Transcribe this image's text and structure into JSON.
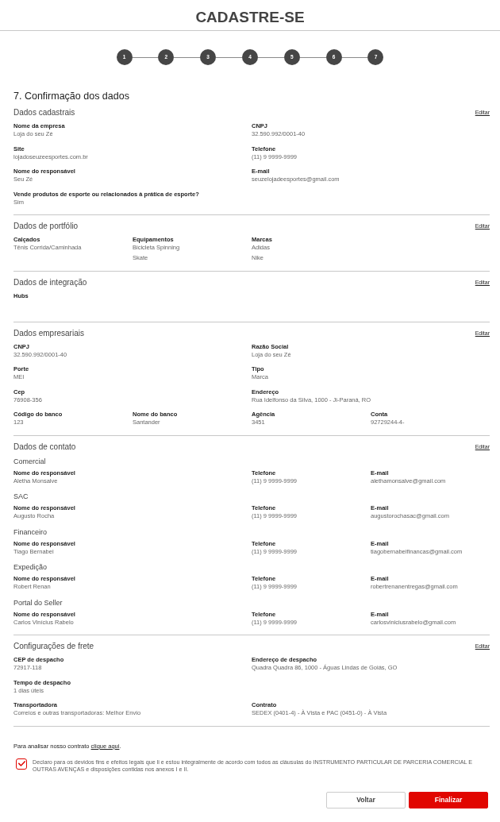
{
  "header": {
    "title": "CADASTRE-SE"
  },
  "steps": [
    {
      "label": "1"
    },
    {
      "label": "2"
    },
    {
      "label": "3"
    },
    {
      "label": "4"
    },
    {
      "label": "5"
    },
    {
      "label": "6"
    },
    {
      "label": "7"
    }
  ],
  "page_title": "7. Confirmação dos dados",
  "sections": [
    {
      "kind": "fields",
      "title": "Dados cadastrais",
      "edit_link": "Editar",
      "rows": [
        {
          "fields": [
            {
              "label": "Nome da empresa",
              "values": [
                "Loja do seu Zé"
              ]
            },
            {
              "label": "CNPJ",
              "values": [
                "32.590.992/0001-40"
              ]
            }
          ]
        },
        {
          "fields": [
            {
              "label": "Site",
              "values": [
                "lojadoseuzeesportes.com.br"
              ]
            },
            {
              "label": "Telefone",
              "values": [
                "(11) 9 9999-9999"
              ]
            }
          ]
        },
        {
          "fields": [
            {
              "label": "Nome do responsável",
              "values": [
                "Seu Zé"
              ]
            },
            {
              "label": "E-mail",
              "values": [
                "seuzelojadeesportes@gmail.com"
              ]
            }
          ]
        },
        {
          "fields": [
            {
              "label": "Vende produtos de esporte ou relacionados à prática de esporte?",
              "values": [
                "Sim"
              ]
            }
          ]
        }
      ]
    },
    {
      "kind": "portfolio",
      "title": "Dados de portfólio",
      "edit_link": "Editar",
      "rows": [
        {
          "fields": [
            {
              "label": "Calçados",
              "values": [
                "Tênis Corrida/Caminhada"
              ]
            },
            {
              "label": "Equipamentos",
              "values": [
                "Bicicleta Spinning",
                "Skate"
              ]
            },
            {
              "label": "Marcas",
              "values": [
                "Adidas",
                "Nike"
              ]
            }
          ]
        }
      ]
    },
    {
      "kind": "fields",
      "title": "Dados de integração",
      "edit_link": "Editar",
      "rows": [
        {
          "fields": [
            {
              "label": "Hubs"
            }
          ]
        }
      ]
    },
    {
      "kind": "fields",
      "title": "Dados empresariais",
      "edit_link": "Editar",
      "rows": [
        {
          "fields": [
            {
              "label": "CNPJ",
              "values": [
                "32.590.992/0001-40"
              ]
            },
            {
              "label": "Razão Social",
              "values": [
                "Loja do seu Zé"
              ]
            }
          ]
        },
        {
          "fields": [
            {
              "label": "Porte",
              "values": [
                "MEI"
              ]
            },
            {
              "label": "Tipo",
              "values": [
                "Marca"
              ]
            }
          ]
        },
        {
          "fields": [
            {
              "label": "Cep",
              "values": [
                "76908-356"
              ]
            },
            {
              "label": "Endereço",
              "values": [
                "Rua Idelfonso da Silva, 1000 - Ji-Paraná, RO"
              ]
            }
          ]
        },
        {
          "fields": [
            {
              "label": "Código do banco",
              "values": [
                "123"
              ]
            },
            {
              "label": "Nome do banco",
              "values": [
                "Santander"
              ]
            },
            {
              "label": "Agência",
              "values": [
                "3451"
              ]
            },
            {
              "label": "Conta",
              "values": [
                "92729244-4-"
              ]
            }
          ]
        }
      ]
    },
    {
      "kind": "contacts",
      "title": "Dados de contato",
      "edit_link": "Editar",
      "rows": [
        {
          "heading": "Comercial",
          "fields": [
            {
              "label": "Nome do responsável",
              "values": [
                "Aletha Monsalve"
              ]
            },
            {
              "label": "Telefone",
              "values": [
                "(11) 9 9999-9999"
              ]
            },
            {
              "label": "E-mail",
              "values": [
                "alethamonsalve@gmail.com"
              ]
            }
          ]
        },
        {
          "heading": "SAC",
          "fields": [
            {
              "label": "Nome do responsável",
              "values": [
                "Augusto Rocha"
              ]
            },
            {
              "label": "Telefone",
              "values": [
                "(11) 9 9999-9999"
              ]
            },
            {
              "label": "E-mail",
              "values": [
                "augustorochasac@gmail.com"
              ]
            }
          ]
        },
        {
          "heading": "Financeiro",
          "fields": [
            {
              "label": "Nome do responsável",
              "values": [
                "Tiago Bernabei"
              ]
            },
            {
              "label": "Telefone",
              "values": [
                "(11) 9 9999-9999"
              ]
            },
            {
              "label": "E-mail",
              "values": [
                "tiagobernabeifinancas@gmail.com"
              ]
            }
          ]
        },
        {
          "heading": "Expedição",
          "fields": [
            {
              "label": "Nome do responsável",
              "values": [
                "Robert Renan"
              ]
            },
            {
              "label": "Telefone",
              "values": [
                "(11) 9 9999-9999"
              ]
            },
            {
              "label": "E-mail",
              "values": [
                "robertrenanentregas@gmail.com"
              ]
            }
          ]
        },
        {
          "heading": "Portal do Seller",
          "fields": [
            {
              "label": "Nome do responsável",
              "values": [
                "Carlos Vinícius Rabelo"
              ]
            },
            {
              "label": "Telefone",
              "values": [
                "(11) 9 9999-9999"
              ]
            },
            {
              "label": "E-mail",
              "values": [
                "carlosviniciusrabelo@gmail.com"
              ]
            }
          ]
        }
      ]
    },
    {
      "kind": "fields",
      "title": "Configurações de frete",
      "edit_link": "Editar",
      "rows": [
        {
          "fields": [
            {
              "label": "CEP de despacho",
              "values": [
                "72917-118"
              ]
            },
            {
              "label": "Endereço de despacho",
              "values": [
                "Quadra Quadra 86, 1000 - Águas Lindas de Goiás, GO"
              ]
            }
          ]
        },
        {
          "fields": [
            {
              "label": "Tempo de despacho",
              "values": [
                "1 dias úteis"
              ]
            }
          ]
        },
        {
          "fields": [
            {
              "label": "Transportadora",
              "values": [
                "Correios e outras transportadoras: Melhor Envio"
              ]
            },
            {
              "label": "Contrato",
              "values": [
                "SEDEX (0401-4) - À Vista e PAC (0451-0) - À Vista"
              ]
            }
          ]
        }
      ]
    }
  ],
  "contract_note": {
    "text": "Para analisar nosso contrato",
    "link": "clique aqui",
    "suffix": "."
  },
  "declaration": {
    "checked": true,
    "text": "Declaro para os devidos fins e efeitos legais que li e estou integralmente de acordo com todos as cláusulas do INSTRUMENTO PARTICULAR DE PARCERIA COMERCIAL E OUTRAS AVENÇAS e disposições contidas nos anexos I e II."
  },
  "buttons": [
    {
      "kind": "secondary",
      "label": "Voltar"
    },
    {
      "kind": "primary",
      "label": "Finalizar"
    }
  ]
}
